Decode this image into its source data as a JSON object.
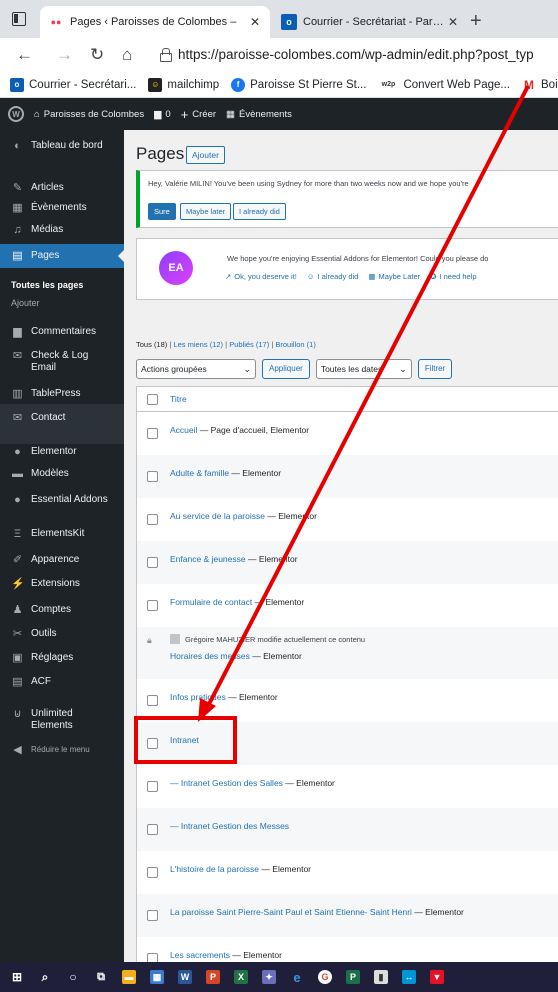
{
  "browser": {
    "tabs": [
      {
        "label": "Pages ‹ Paroisses de Colombes –",
        "active": true
      },
      {
        "label": "Courrier - Secrétariat - Paroisse",
        "active": false
      }
    ],
    "new_tab": "+",
    "url": "https://paroisse-colombes.com/wp-admin/edit.php?post_typ",
    "bookmarks": [
      {
        "label": "Courrier - Secrétari...",
        "icon": "outlook-icon",
        "color": "#0a5fb4"
      },
      {
        "label": "mailchimp",
        "icon": "mailchimp-icon",
        "color": "#222222"
      },
      {
        "label": "Paroisse St Pierre St...",
        "icon": "facebook-icon",
        "color": "#1877f2"
      },
      {
        "label": "Convert Web Page...",
        "icon": "w2p-icon",
        "color": "#333333"
      },
      {
        "label": "Boit",
        "icon": "gmail-icon",
        "color": "#d93025"
      }
    ]
  },
  "adminbar": {
    "site": "Paroisses de Colombes",
    "comments": "0",
    "create": "Créer",
    "events": "Évènements"
  },
  "sidebar": {
    "items": [
      {
        "label": "Tableau de bord",
        "icon": "dashboard-icon"
      },
      {
        "label": "Articles",
        "icon": "pin-icon"
      },
      {
        "label": "Évènements",
        "icon": "calendar-icon"
      },
      {
        "label": "Médias",
        "icon": "media-icon"
      },
      {
        "label": "Pages",
        "icon": "page-icon"
      },
      {
        "label": "Commentaires",
        "icon": "comment-icon"
      },
      {
        "label": "Check & Log Email",
        "icon": "email-icon"
      },
      {
        "label": "TablePress",
        "icon": "table-icon"
      },
      {
        "label": "Contact",
        "icon": "mail-icon"
      },
      {
        "label": "Elementor",
        "icon": "elementor-icon"
      },
      {
        "label": "Modèles",
        "icon": "folder-icon"
      },
      {
        "label": "Essential Addons",
        "icon": "ea-icon"
      },
      {
        "label": "ElementsKit",
        "icon": "elementskit-icon"
      },
      {
        "label": "Apparence",
        "icon": "brush-icon"
      },
      {
        "label": "Extensions",
        "icon": "plugin-icon"
      },
      {
        "label": "Comptes",
        "icon": "user-icon"
      },
      {
        "label": "Outils",
        "icon": "wrench-icon"
      },
      {
        "label": "Réglages",
        "icon": "settings-icon"
      },
      {
        "label": "ACF",
        "icon": "acf-icon"
      },
      {
        "label": "Unlimited Elements",
        "icon": "ue-icon"
      },
      {
        "label": "Réduire le menu",
        "icon": "collapse-icon"
      }
    ],
    "submenu": [
      "Toutes les pages",
      "Ajouter"
    ]
  },
  "main": {
    "title": "Pages",
    "add_button": "Ajouter",
    "notice1": {
      "message": "Hey, Valérie MILIN! You've been using Sydney for more than two weeks now and we hope you're",
      "buttons": [
        "Sure",
        "Maybe later",
        "I already did"
      ]
    },
    "notice2": {
      "logo": "EA",
      "message": "We hope you're enjoying Essential Addons for Elementor! Could you please do",
      "links": [
        "Ok, you deserve it!",
        "I already did",
        "Maybe Later",
        "I need help"
      ]
    },
    "filters": {
      "all": "Tous",
      "all_count": "(18)",
      "mine": "Les miens",
      "mine_count": "(12)",
      "published": "Publiés",
      "published_count": "(17)",
      "draft": "Brouillon",
      "draft_count": "(1)",
      "sep": "|"
    },
    "tablenav": {
      "bulk_actions": "Actions groupées",
      "apply": "Appliquer",
      "dates": "Toutes les dates",
      "filter": "Filtrer"
    },
    "table": {
      "column_title": "Titre",
      "rows": [
        {
          "title": "Accueil",
          "suffix": " — Page d'accueil, Elementor"
        },
        {
          "title": "Adulte & famille",
          "suffix": " — Elementor"
        },
        {
          "title": "Au service de la paroisse",
          "suffix": " — Elementor"
        },
        {
          "title": "Enfance & jeunesse",
          "suffix": " — Elementor"
        },
        {
          "title": "Formulaire de contact",
          "suffix": " — Elementor"
        },
        {
          "title": "Horaires des messes",
          "suffix": " — Elementor",
          "lock": "Grégoire MAHUZIER modifie actuellement ce contenu"
        },
        {
          "title": "Infos pratiques",
          "suffix": " — Elementor"
        },
        {
          "title": "Intranet",
          "suffix": ""
        },
        {
          "title": "— Intranet Gestion des Salles",
          "suffix": " — Elementor"
        },
        {
          "title": "— Intranet Gestion des Messes",
          "suffix": ""
        },
        {
          "title": "L'histoire de la paroisse",
          "suffix": " — Elementor"
        },
        {
          "title": "La paroisse Saint Pierre-Saint Paul et Saint Etienne- Saint Henri",
          "suffix": " — Elementor"
        },
        {
          "title": "Les sacrements",
          "suffix": " — Elementor"
        }
      ]
    }
  },
  "colors": {
    "wp_dark": "#1d2327",
    "wp_blue": "#2271b1",
    "annotation_red": "#e60000"
  }
}
